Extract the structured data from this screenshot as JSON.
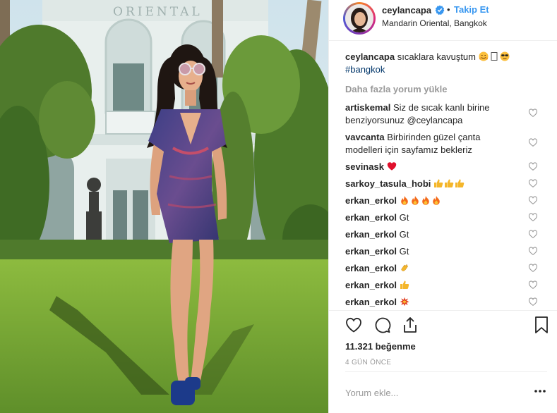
{
  "header": {
    "username": "ceylancapa",
    "follow_separator": "•",
    "follow_label": "Takip Et",
    "location": "Mandarin Oriental, Bangkok"
  },
  "photo": {
    "building_sign": "ORIENTAL"
  },
  "caption": {
    "username": "ceylancapa",
    "text": "sıcaklara kavuştum",
    "emojis": [
      "hugging-face",
      "missing-glyph",
      "sunglasses-face"
    ],
    "hashtag": "#bangkok"
  },
  "load_more_label": "Daha fazla yorum yükle",
  "comments": [
    {
      "username": "artiskemal",
      "text": "Siz de sıcak kanlı birine",
      "text2": "benziyorsunuz @ceylancapa",
      "emojis": []
    },
    {
      "username": "vavcanta",
      "text": "Birbirinden güzel çanta",
      "text2": "modelleri için sayfamız bekleriz",
      "emojis": []
    },
    {
      "username": "sevinask",
      "text": "",
      "emojis": [
        "red-heart"
      ]
    },
    {
      "username": "sarkoy_tasula_hobi",
      "text": "",
      "emojis": [
        "thumbs-up",
        "thumbs-up",
        "thumbs-up"
      ]
    },
    {
      "username": "erkan_erkol",
      "text": "",
      "emojis": [
        "fire",
        "fire",
        "fire",
        "fire"
      ]
    },
    {
      "username": "erkan_erkol",
      "text": "Gt",
      "emojis": []
    },
    {
      "username": "erkan_erkol",
      "text": "Gt",
      "emojis": []
    },
    {
      "username": "erkan_erkol",
      "text": "Gt",
      "emojis": []
    },
    {
      "username": "erkan_erkol",
      "text": "",
      "emojis": [
        "clapping-hands"
      ]
    },
    {
      "username": "erkan_erkol",
      "text": "",
      "emojis": [
        "thumbs-up"
      ]
    },
    {
      "username": "erkan_erkol",
      "text": "",
      "emojis": [
        "collision"
      ]
    }
  ],
  "likes": "11.321 beğenme",
  "timestamp": "4 GÜN ÖNCE",
  "add_comment_placeholder": "Yorum ekle...",
  "colors": {
    "link": "#3897f0",
    "hashtag": "#003569",
    "muted": "#999999",
    "text": "#262626",
    "border": "#efefef"
  }
}
